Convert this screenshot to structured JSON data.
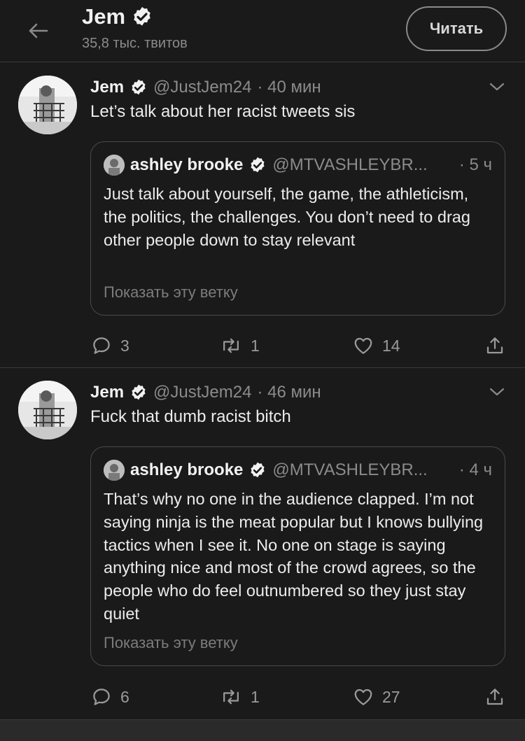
{
  "header": {
    "name": "Jem",
    "tweet_count": "35,8 тыс. твитов",
    "follow_label": "Читать",
    "back_icon": "arrow-left-icon",
    "verified_icon": "verified-badge-icon"
  },
  "tweets": [
    {
      "name": "Jem",
      "handle": "@JustJem24",
      "time": "· 40 мин",
      "text": "Let’s talk about her racist tweets sis",
      "quote": {
        "name": "ashley brooke",
        "handle": "@MTVASHLEYBR...",
        "time": "· 5 ч",
        "text": "Just talk about yourself, the game, the athleticism, the politics, the challenges. You don’t need to drag other people down to stay relevant",
        "show_thread": "Показать эту ветку"
      },
      "replies": "3",
      "retweets": "1",
      "likes": "14"
    },
    {
      "name": "Jem",
      "handle": "@JustJem24",
      "time": "· 46 мин",
      "text": "Fuck that dumb racist bitch",
      "quote": {
        "name": "ashley brooke",
        "handle": "@MTVASHLEYBR...",
        "time": "· 4 ч",
        "text": "That’s why no one in the audience clapped. I’m not saying ninja is the meat popular but I knows bullying tactics when I see it. No one on stage is saying anything nice and most of the crowd agrees, so the people who do feel outnumbered so they just stay quiet",
        "show_thread": "Показать эту ветку"
      },
      "replies": "6",
      "retweets": "1",
      "likes": "27"
    }
  ],
  "colors": {
    "background": "#1a1a1a",
    "text": "#e8e8e8",
    "muted": "#8b8b8b",
    "border": "#3a3a3a"
  }
}
